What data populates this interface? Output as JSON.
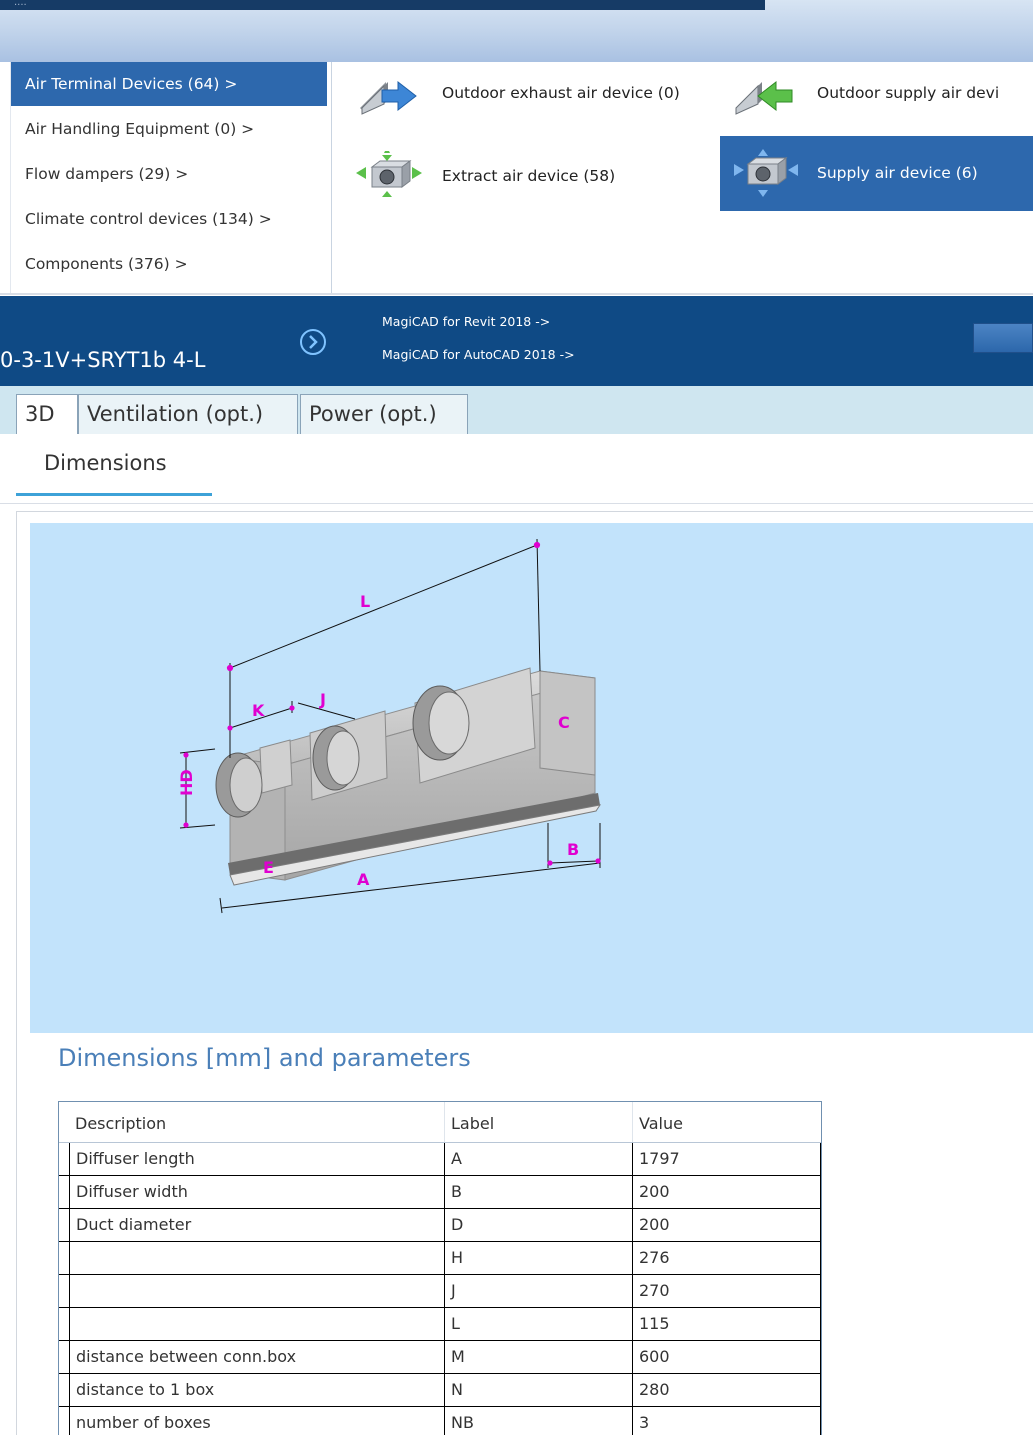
{
  "header": {
    "dots": "...."
  },
  "categories": [
    {
      "label": "Air Terminal Devices (64)  >",
      "selected": true
    },
    {
      "label": "Air Handling Equipment (0)  >",
      "selected": false
    },
    {
      "label": "Flow dampers (29)  >",
      "selected": false
    },
    {
      "label": "Climate control devices (134)  >",
      "selected": false
    },
    {
      "label": "Components (376)  >",
      "selected": false
    }
  ],
  "devices": [
    {
      "label": "Outdoor exhaust air device (0)",
      "icon": "outdoor-exhaust-icon"
    },
    {
      "label": "Outdoor supply air devi",
      "icon": "outdoor-supply-icon"
    },
    {
      "label": "Extract air device (58)",
      "icon": "extract-air-icon"
    },
    {
      "label": "Supply air device (6)",
      "icon": "supply-air-icon",
      "selected": true
    }
  ],
  "product": {
    "name": "0-3-1V+SRYT1b 4-L",
    "links": [
      "MagiCAD for Revit 2018 ->",
      "MagiCAD for AutoCAD 2018 ->"
    ]
  },
  "tabs": [
    "3D",
    "Ventilation (opt.)",
    "Power (opt.)"
  ],
  "subtab": "Dimensions",
  "drawing_labels": {
    "L": "L",
    "K": "K",
    "J": "J",
    "C": "C",
    "HD": "HD",
    "A": "A",
    "B": "B",
    "E": "E"
  },
  "dimensions": {
    "title": "Dimensions [mm] and parameters",
    "headers": [
      "Description",
      "Label",
      "Value"
    ],
    "rows": [
      [
        "Diffuser length",
        "A",
        "1797"
      ],
      [
        "Diffuser width",
        "B",
        "200"
      ],
      [
        "Duct diameter",
        "D",
        "200"
      ],
      [
        "",
        "H",
        "276"
      ],
      [
        "",
        "J",
        "270"
      ],
      [
        "",
        "L",
        "115"
      ],
      [
        "distance between conn.box",
        "M",
        "600"
      ],
      [
        "distance to 1 box",
        "N",
        "280"
      ],
      [
        "number of boxes",
        "NB",
        "3"
      ]
    ]
  },
  "colors": {
    "selected": "#2d68ad",
    "band": "#0f4a85",
    "view_bg": "#c2e3fb",
    "dim_title": "#4a7fb8",
    "dim_lines": "#e000d0"
  }
}
